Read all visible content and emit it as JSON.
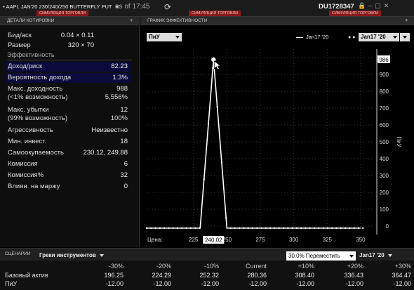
{
  "window": {
    "title": "AAPL JAN'20 230/240/250 BUTTERFLY PUT",
    "sim_tag_left": "СИМУЛЯЦИЯ ТОРГОВЛИ",
    "sim_tag_mid": "СИМУЛЯЦИЯ ТОРГОВЛИ",
    "sim_tag_right": "СИМУЛЯЦИЯ ТОРГОВЛИ",
    "as_of": "as of 17:45",
    "account": "DU1728347"
  },
  "quote_panel": {
    "title": "ДЕТАЛИ КОТИРОВКИ",
    "bid_ask_label": "Бид/аск",
    "bid_ask_value": "0.04 × 0.11",
    "size_label": "Размер",
    "size_value": "320 × 70",
    "section_title": "Эффективность",
    "rows": [
      {
        "label": "Доход/риск",
        "value": "82.23"
      },
      {
        "label": "Вероятность дохода",
        "value": "1.3%"
      },
      {
        "label": "Макс. доходность",
        "label2": "(<1% возможность)",
        "value": "988",
        "value2": "5,556%"
      },
      {
        "label": "Макс. убытки",
        "label2": "(99% возможность)",
        "value": "12",
        "value2": "100%"
      },
      {
        "label": "Агрессивность",
        "value": "Неизвестно"
      },
      {
        "label": "Мин. инвест.",
        "value": "18"
      },
      {
        "label": "Самоокупаемость",
        "value": "230.12, 249.88"
      },
      {
        "label": "Комиссия",
        "value": "6"
      },
      {
        "label": "Комиссия%",
        "value": "32"
      },
      {
        "label": "Влиян. на маржу",
        "value": "0"
      }
    ]
  },
  "chart_panel": {
    "title": "ГРАФИК ЭФФЕКТИВНОСТИ",
    "mode_select": "ПиУ",
    "expiry_select": "Jan17 '20",
    "legend_solid": "Jan17 '20",
    "y_axis_label": "ПиУ",
    "x_axis_prefix": "Цена:",
    "cursor_price": "240.02",
    "cursor_value": "986",
    "colors": {
      "line": "#ffffff",
      "highlight": "#ffffff"
    }
  },
  "chart_data": {
    "type": "line",
    "x": [
      190,
      229.5,
      230,
      240,
      250,
      250.5,
      350
    ],
    "series": [
      {
        "name": "Jan17 '20",
        "values": [
          -12,
          -12,
          -12,
          988,
          -12,
          -12,
          -12
        ]
      }
    ],
    "xticks": [
      "225",
      "250",
      "275",
      "300",
      "325",
      "350"
    ],
    "yticks": [
      "0",
      "100",
      "200",
      "300",
      "400",
      "500",
      "600",
      "700",
      "800",
      "900",
      "1000"
    ],
    "xlim": [
      190,
      360
    ],
    "ylim": [
      -50,
      1050
    ]
  },
  "scenarios": {
    "title": "СЦЕНАРИИ",
    "grid_label": "Греки инструментов",
    "move_select": "30.0% Переместить",
    "expiry_select": "Jan17 '20",
    "columns": [
      "-30%",
      "-20%",
      "-10%",
      "Current",
      "+10%",
      "+20%",
      "+30%"
    ],
    "rows": [
      {
        "label": "Базовый актив",
        "values": [
          "196.25",
          "224.29",
          "252.32",
          "280.36",
          "308.40",
          "336.43",
          "364.47"
        ]
      },
      {
        "label": "ПиУ",
        "values": [
          "-12.00",
          "-12.00",
          "-12.00",
          "-12.00",
          "-12.00",
          "-12.00",
          "-12.00"
        ]
      }
    ]
  }
}
